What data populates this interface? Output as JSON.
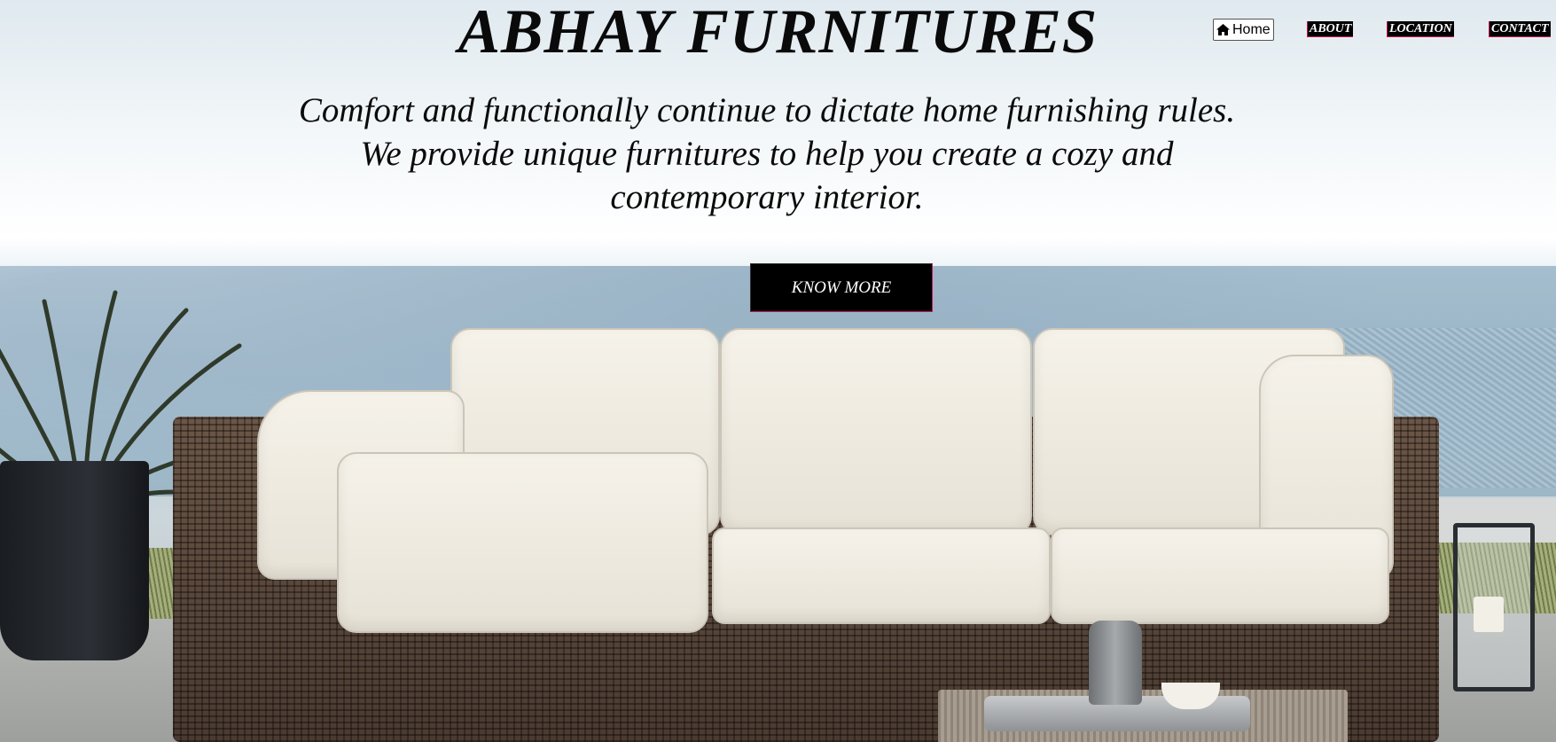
{
  "header": {
    "brand": "ABHAY FURNITURES"
  },
  "nav": {
    "home_label": "Home",
    "home_icon": "home-icon",
    "items": [
      {
        "label": "ABOUT"
      },
      {
        "label": "LOCATION"
      },
      {
        "label": "CONTACT"
      }
    ]
  },
  "hero": {
    "tagline_line1": "Comfort and functionally continue to dictate home furnishing rules.",
    "tagline_line2": "We provide unique furnitures to help you create a cozy and contemporary interior.",
    "cta_label": "KNOW MORE"
  },
  "colors": {
    "button_bg": "#000000",
    "button_border_accent": "#c2185b",
    "text": "#0a0a0a"
  }
}
